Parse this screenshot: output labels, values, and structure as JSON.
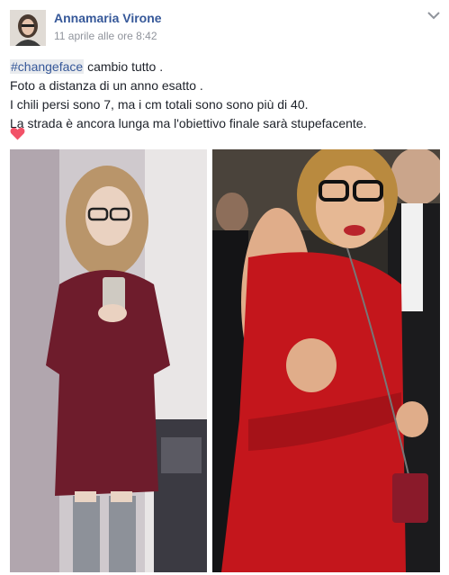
{
  "post": {
    "author": "Annamaria Virone",
    "timestamp": "11 aprile alle ore 8:42",
    "hashtag": "#changeface",
    "line1_rest": " cambio tutto .",
    "line2": "Foto a distanza di un anno esatto .",
    "line3": "I chili persi sono 7, ma i cm totali sono sono più di 40.",
    "line4": "La strada è ancora lunga ma l'obiettivo finale sarà stupefacente."
  },
  "icons": {
    "heart": "heart-icon",
    "more": "chevron-down-icon"
  },
  "colors": {
    "link": "#365899",
    "heart": "#f25268",
    "dress_left": "#6e1c2c",
    "dress_right": "#c4161c"
  }
}
